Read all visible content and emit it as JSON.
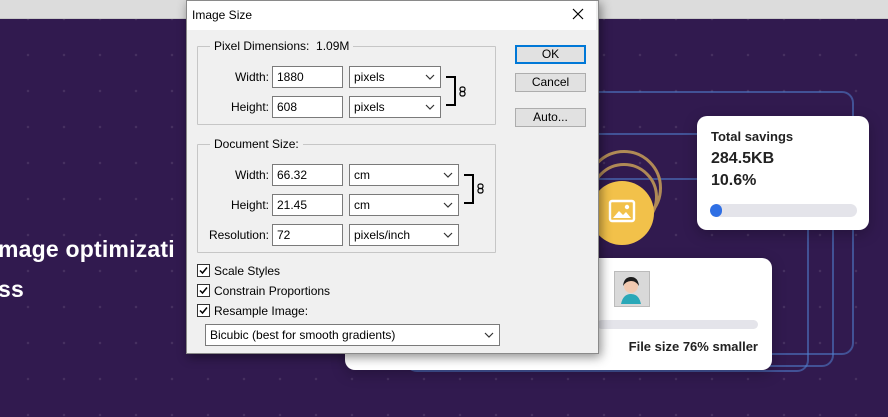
{
  "background": {
    "hero_line1": "mage optimizati",
    "hero_line2": "ss",
    "savings_card": {
      "title": "Total savings",
      "amount": "284.5KB",
      "percent": "10.6%",
      "progress_fraction": 0.08
    },
    "file_card": {
      "caption": "File size 76% smaller"
    }
  },
  "dialog": {
    "title": "Image Size",
    "pixel_dimensions": {
      "legend": "Pixel Dimensions:",
      "size": "1.09M",
      "width_label": "Width:",
      "width_value": "1880",
      "width_unit": "pixels",
      "height_label": "Height:",
      "height_value": "608",
      "height_unit": "pixels"
    },
    "document_size": {
      "legend": "Document Size:",
      "width_label": "Width:",
      "width_value": "66.32",
      "width_unit": "cm",
      "height_label": "Height:",
      "height_value": "21.45",
      "height_unit": "cm",
      "resolution_label": "Resolution:",
      "resolution_value": "72",
      "resolution_unit": "pixels/inch"
    },
    "buttons": {
      "ok": "OK",
      "cancel": "Cancel",
      "auto": "Auto..."
    },
    "options": {
      "scale_styles": "Scale Styles",
      "constrain_proportions": "Constrain Proportions",
      "resample_image": "Resample Image:",
      "resample_method": "Bicubic (best for smooth gradients)"
    }
  },
  "colors": {
    "page_bg": "#311a4f",
    "accent_blue": "#2f6fe4",
    "sun_yellow": "#f2c14a"
  }
}
